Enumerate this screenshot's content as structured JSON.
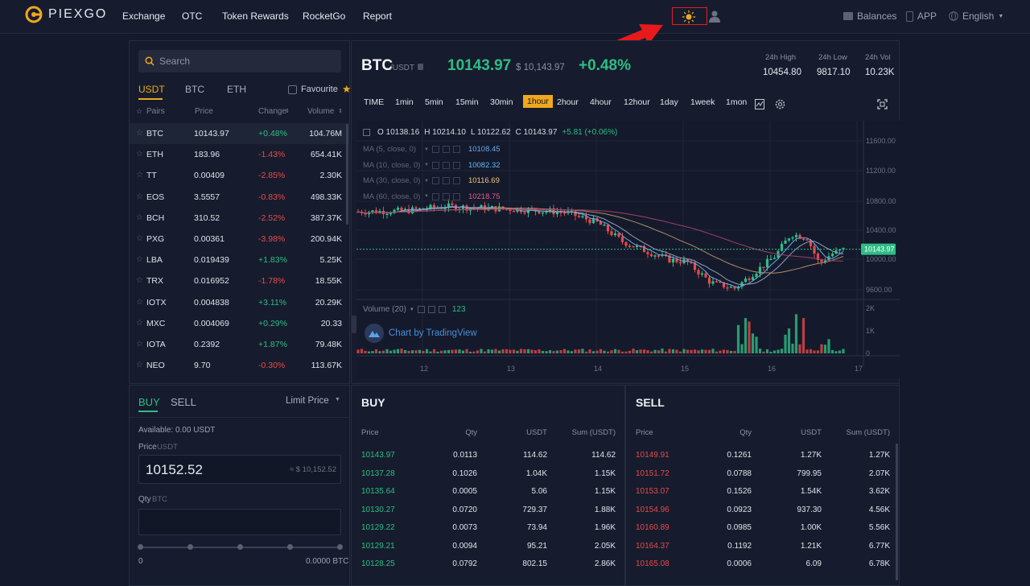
{
  "nav": {
    "logo_text": "PIEXGO",
    "items": [
      "Exchange",
      "OTC",
      "Token Rewards",
      "RocketGo",
      "Report"
    ],
    "balances": "Balances",
    "app": "APP",
    "language": "English"
  },
  "colors": {
    "accent": "#f0a81c",
    "up": "#2ebd85",
    "down": "#e64a4a",
    "highlight": "#e02020"
  },
  "market": {
    "search_placeholder": "Search",
    "tabs": [
      "USDT",
      "BTC",
      "ETH"
    ],
    "favourite": "Favourite",
    "headers": {
      "pairs": "Pairs",
      "price": "Price",
      "change": "Change",
      "volume": "Volume"
    },
    "rows": [
      {
        "pair": "BTC",
        "price": "10143.97",
        "change": "+0.48%",
        "volume": "104.76M",
        "dir": "up"
      },
      {
        "pair": "ETH",
        "price": "183.96",
        "change": "-1.43%",
        "volume": "654.41K",
        "dir": "down"
      },
      {
        "pair": "TT",
        "price": "0.00409",
        "change": "-2.85%",
        "volume": "2.30K",
        "dir": "down"
      },
      {
        "pair": "EOS",
        "price": "3.5557",
        "change": "-0.83%",
        "volume": "498.33K",
        "dir": "down"
      },
      {
        "pair": "BCH",
        "price": "310.52",
        "change": "-2.52%",
        "volume": "387.37K",
        "dir": "down"
      },
      {
        "pair": "PXG",
        "price": "0.00361",
        "change": "-3.98%",
        "volume": "200.94K",
        "dir": "down"
      },
      {
        "pair": "LBA",
        "price": "0.019439",
        "change": "+1.83%",
        "volume": "5.25K",
        "dir": "up"
      },
      {
        "pair": "TRX",
        "price": "0.016952",
        "change": "-1.78%",
        "volume": "18.55K",
        "dir": "down"
      },
      {
        "pair": "IOTX",
        "price": "0.004838",
        "change": "+3.11%",
        "volume": "20.29K",
        "dir": "up"
      },
      {
        "pair": "MXC",
        "price": "0.004069",
        "change": "+0.29%",
        "volume": "20.33",
        "dir": "up"
      },
      {
        "pair": "IOTA",
        "price": "0.2392",
        "change": "+1.87%",
        "volume": "79.48K",
        "dir": "up"
      },
      {
        "pair": "NEO",
        "price": "9.70",
        "change": "-0.30%",
        "volume": "113.67K",
        "dir": "down"
      }
    ]
  },
  "ticker": {
    "base": "BTC",
    "quote": "/USDT",
    "last": "10143.97",
    "usd": "$ 10,143.97",
    "change": "+0.48%",
    "high_label": "24h High",
    "high": "10454.80",
    "low_label": "24h Low",
    "low": "9817.10",
    "vol_label": "24h Vol",
    "vol": "10.23K"
  },
  "chart": {
    "timeframes": [
      "TIME",
      "1min",
      "5min",
      "15min",
      "30min",
      "1hour",
      "2hour",
      "4hour",
      "12hour",
      "1day",
      "1week",
      "1mon"
    ],
    "active_timeframe": "1hour",
    "ohlc": {
      "o": "O 10138.16",
      "h": "H 10214.10",
      "l": "L 10122.62",
      "c": "C 10143.97",
      "chg": "+5.81 (+0.06%)"
    },
    "ma": [
      {
        "label": "MA (5, close, 0)",
        "value": "10108.45",
        "color": "#6aa7e8"
      },
      {
        "label": "MA (10, close, 0)",
        "value": "10082.32",
        "color": "#64b5f6"
      },
      {
        "label": "MA (30, close, 0)",
        "value": "10116.69",
        "color": "#f6c177"
      },
      {
        "label": "MA (60, close, 0)",
        "value": "10218.75",
        "color": "#e85a8a"
      }
    ],
    "volume_label": "Volume (20)",
    "volume_value": "123",
    "watermark": "Chart by TradingView",
    "price_ticks": [
      "11600.00",
      "11200.00",
      "10800.00",
      "10400.00",
      "10000.00",
      "9600.00"
    ],
    "vol_ticks": [
      "2K",
      "1K",
      "0"
    ],
    "x_ticks": [
      "12",
      "13",
      "14",
      "15",
      "16",
      "17"
    ],
    "last_price_tag": "10143.97"
  },
  "order_form": {
    "buy": "BUY",
    "sell": "SELL",
    "type": "Limit Price",
    "available": "Available:  0.00 USDT",
    "price_label": "Price",
    "price_unit": "USDT",
    "price_value": "10152.52",
    "price_usd": "≈ $ 10,152.52",
    "qty_label": "Qty",
    "qty_unit": "BTC",
    "slider_min": "0",
    "slider_max": "0.0000 BTC"
  },
  "orderbook_buy": {
    "title": "BUY",
    "headers": [
      "Price",
      "Qty",
      "USDT",
      "Sum (USDT)"
    ],
    "rows": [
      [
        "10143.97",
        "0.0113",
        "114.62",
        "114.62"
      ],
      [
        "10137.28",
        "0.1026",
        "1.04K",
        "1.15K"
      ],
      [
        "10135.64",
        "0.0005",
        "5.06",
        "1.15K"
      ],
      [
        "10130.27",
        "0.0720",
        "729.37",
        "1.88K"
      ],
      [
        "10129.22",
        "0.0073",
        "73.94",
        "1.96K"
      ],
      [
        "10129.21",
        "0.0094",
        "95.21",
        "2.05K"
      ],
      [
        "10128.25",
        "0.0792",
        "802.15",
        "2.86K"
      ]
    ]
  },
  "orderbook_sell": {
    "title": "SELL",
    "headers": [
      "Price",
      "Qty",
      "USDT",
      "Sum (USDT)"
    ],
    "rows": [
      [
        "10149.91",
        "0.1261",
        "1.27K",
        "1.27K"
      ],
      [
        "10151.72",
        "0.0788",
        "799.95",
        "2.07K"
      ],
      [
        "10153.07",
        "0.1526",
        "1.54K",
        "3.62K"
      ],
      [
        "10154.96",
        "0.0923",
        "937.30",
        "4.56K"
      ],
      [
        "10160.89",
        "0.0985",
        "1.00K",
        "5.56K"
      ],
      [
        "10164.37",
        "0.1192",
        "1.21K",
        "6.77K"
      ],
      [
        "10165.08",
        "0.0006",
        "6.09",
        "6.78K"
      ]
    ]
  }
}
